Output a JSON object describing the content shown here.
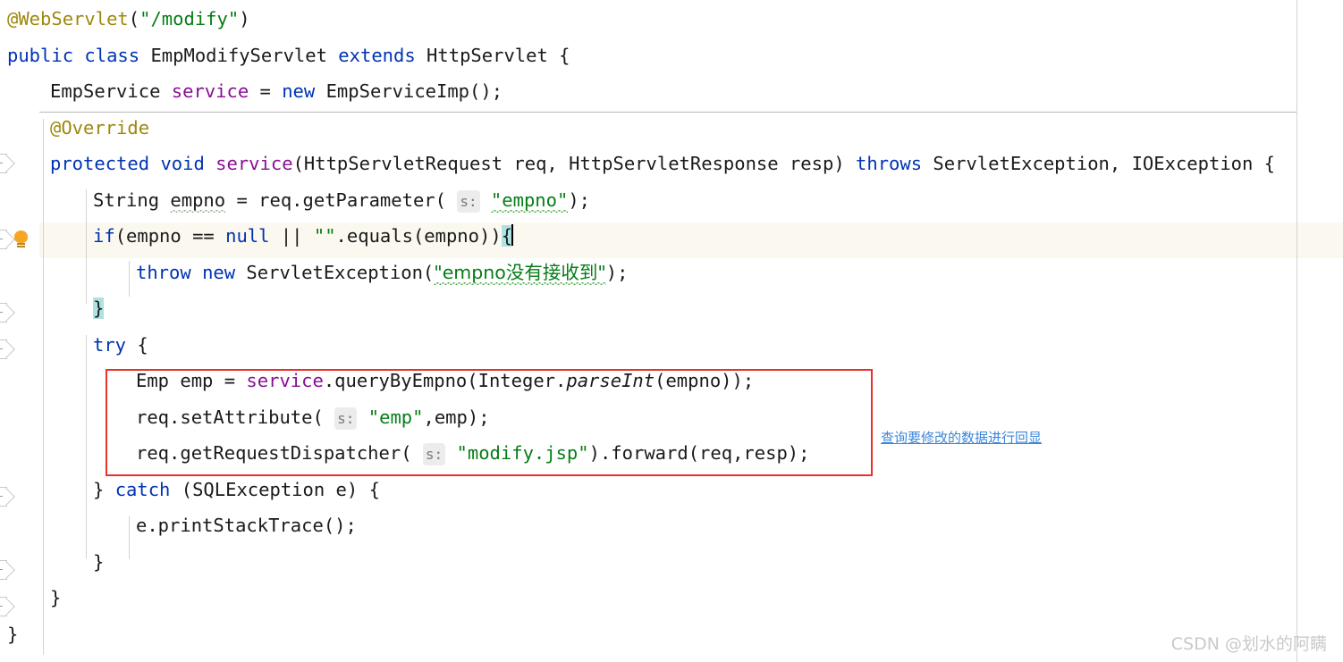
{
  "editor": {
    "language": "java",
    "theme": "IntelliJ Light",
    "colors": {
      "background": "#ffffff",
      "keyword": "#0033b3",
      "annotation": "#9e880d",
      "string": "#067d17",
      "field": "#871094",
      "text": "#1a1a1a",
      "caret_line": "#fbf8ef",
      "brace_highlight": "#aee2e2",
      "red_box": "#e8312a",
      "note_text": "#3d87d8",
      "watermark": "#c9c9c9",
      "indent_guide": "#d4d4d4",
      "right_margin": "#d2d2d2"
    },
    "code_lines": [
      {
        "n": 1,
        "indent": 0,
        "tokens": [
          {
            "t": "@WebServlet",
            "k": "ann"
          },
          {
            "t": "(",
            "k": "stat"
          },
          {
            "t": "\"/modify\"",
            "k": "str"
          },
          {
            "t": ")",
            "k": "stat"
          }
        ]
      },
      {
        "n": 2,
        "indent": 0,
        "tokens": [
          {
            "t": "public",
            "k": "kw"
          },
          {
            "t": " ",
            "k": "stat"
          },
          {
            "t": "class",
            "k": "kw"
          },
          {
            "t": " EmpModifyServlet ",
            "k": "stat"
          },
          {
            "t": "extends",
            "k": "kw"
          },
          {
            "t": " HttpServlet {",
            "k": "stat"
          }
        ]
      },
      {
        "n": 3,
        "indent": 1,
        "tokens": [
          {
            "t": "EmpService ",
            "k": "stat"
          },
          {
            "t": "service",
            "k": "field"
          },
          {
            "t": " = ",
            "k": "stat"
          },
          {
            "t": "new",
            "k": "kw"
          },
          {
            "t": " EmpServiceImp();",
            "k": "stat"
          }
        ]
      },
      {
        "n": 4,
        "indent": 1,
        "tokens": [
          {
            "t": "@Override",
            "k": "ann"
          }
        ]
      },
      {
        "n": 5,
        "indent": 1,
        "tokens": [
          {
            "t": "protected",
            "k": "kw"
          },
          {
            "t": " ",
            "k": "stat"
          },
          {
            "t": "void",
            "k": "kw"
          },
          {
            "t": " ",
            "k": "stat"
          },
          {
            "t": "service",
            "k": "field"
          },
          {
            "t": "(HttpServletRequest req, HttpServletResponse resp) ",
            "k": "stat"
          },
          {
            "t": "throws",
            "k": "kw"
          },
          {
            "t": " ServletException, IOException {",
            "k": "stat"
          }
        ]
      },
      {
        "n": 6,
        "indent": 2,
        "tokens": [
          {
            "t": "String ",
            "k": "stat"
          },
          {
            "t": "empno",
            "k": "squig-gray"
          },
          {
            "t": " = req.getParameter( ",
            "k": "stat"
          },
          {
            "t": "s:",
            "k": "hint"
          },
          {
            "t": " ",
            "k": "stat"
          },
          {
            "t": "\"empno\"",
            "k": "str-squig"
          },
          {
            "t": ");",
            "k": "stat"
          }
        ]
      },
      {
        "n": 7,
        "indent": 2,
        "caret_line": true,
        "tokens": [
          {
            "t": "if",
            "k": "kw"
          },
          {
            "t": "(empno == ",
            "k": "stat"
          },
          {
            "t": "null",
            "k": "kw"
          },
          {
            "t": " || ",
            "k": "stat"
          },
          {
            "t": "\"\"",
            "k": "str"
          },
          {
            "t": ".equals(empno))",
            "k": "stat"
          },
          {
            "t": "{",
            "k": "brace-hl"
          },
          {
            "t": "caret",
            "k": "caret"
          }
        ]
      },
      {
        "n": 8,
        "indent": 3,
        "tokens": [
          {
            "t": "throw",
            "k": "kw"
          },
          {
            "t": " ",
            "k": "stat"
          },
          {
            "t": "new",
            "k": "kw"
          },
          {
            "t": " ServletException(",
            "k": "stat"
          },
          {
            "t": "\"empno没有接收到\"",
            "k": "str-squig"
          },
          {
            "t": ");",
            "k": "stat"
          }
        ]
      },
      {
        "n": 9,
        "indent": 2,
        "tokens": [
          {
            "t": "}",
            "k": "brace-hl"
          }
        ]
      },
      {
        "n": 10,
        "indent": 2,
        "tokens": [
          {
            "t": "try",
            "k": "kw"
          },
          {
            "t": " {",
            "k": "stat"
          }
        ]
      },
      {
        "n": 11,
        "indent": 3,
        "in_red_box": true,
        "tokens": [
          {
            "t": "Emp emp = ",
            "k": "stat"
          },
          {
            "t": "service",
            "k": "field"
          },
          {
            "t": ".queryByEmpno(Integer.",
            "k": "stat"
          },
          {
            "t": "parseInt",
            "k": "ital"
          },
          {
            "t": "(empno));",
            "k": "stat"
          }
        ]
      },
      {
        "n": 12,
        "indent": 3,
        "in_red_box": true,
        "tokens": [
          {
            "t": "req.setAttribute( ",
            "k": "stat"
          },
          {
            "t": "s:",
            "k": "hint"
          },
          {
            "t": " ",
            "k": "stat"
          },
          {
            "t": "\"emp\"",
            "k": "str"
          },
          {
            "t": ",emp);",
            "k": "stat"
          }
        ]
      },
      {
        "n": 13,
        "indent": 3,
        "in_red_box": true,
        "tokens": [
          {
            "t": "req.getRequestDispatcher( ",
            "k": "stat"
          },
          {
            "t": "s:",
            "k": "hint"
          },
          {
            "t": " ",
            "k": "stat"
          },
          {
            "t": "\"modify.jsp\"",
            "k": "str"
          },
          {
            "t": ").forward(req,resp);",
            "k": "stat"
          }
        ]
      },
      {
        "n": 14,
        "indent": 2,
        "tokens": [
          {
            "t": "} ",
            "k": "stat"
          },
          {
            "t": "catch",
            "k": "kw"
          },
          {
            "t": " (SQLException e) {",
            "k": "stat"
          }
        ]
      },
      {
        "n": 15,
        "indent": 3,
        "tokens": [
          {
            "t": "e.printStackTrace();",
            "k": "stat"
          }
        ]
      },
      {
        "n": 16,
        "indent": 2,
        "tokens": [
          {
            "t": "}",
            "k": "stat"
          }
        ]
      },
      {
        "n": 17,
        "indent": 1,
        "tokens": [
          {
            "t": "}",
            "k": "stat"
          }
        ]
      },
      {
        "n": 18,
        "indent": 0,
        "tokens": [
          {
            "t": "}",
            "k": "stat"
          }
        ]
      }
    ]
  },
  "annotation": {
    "note_text": "查询要修改的数据进行回显",
    "red_box_label": "highlighted-code-region"
  },
  "watermark": {
    "text": "CSDN @划水的阿瞒"
  },
  "gutter": {
    "bulb_tooltip": "intention-action",
    "fold_markers": 7
  }
}
